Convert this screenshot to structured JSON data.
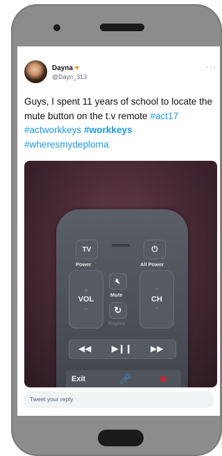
{
  "tweet": {
    "author_name": "Dayna",
    "author_handle": "@Dayn_313",
    "more_icon": "more-horizontal-icon",
    "body_text": "Guys, I spent 11 years of school to locate the mute button on the t.v remote",
    "hashtags": [
      "#act17",
      "#actworkkeys",
      "#workkeys",
      "#wheresmydeploma"
    ]
  },
  "photo": {
    "remote": {
      "tv_label": "TV",
      "power_label": "Power",
      "all_power_label": "All Power",
      "vol_label": "VOL",
      "mute_label": "Mute",
      "replay_label": "Replay",
      "ch_label": "CH",
      "exit_label": "Exit"
    }
  },
  "reply": {
    "placeholder": "Tweet your reply"
  },
  "colors": {
    "link": "#1d9bf0",
    "heart": "#f08a1c",
    "phone_body": "#8c8c8c"
  }
}
